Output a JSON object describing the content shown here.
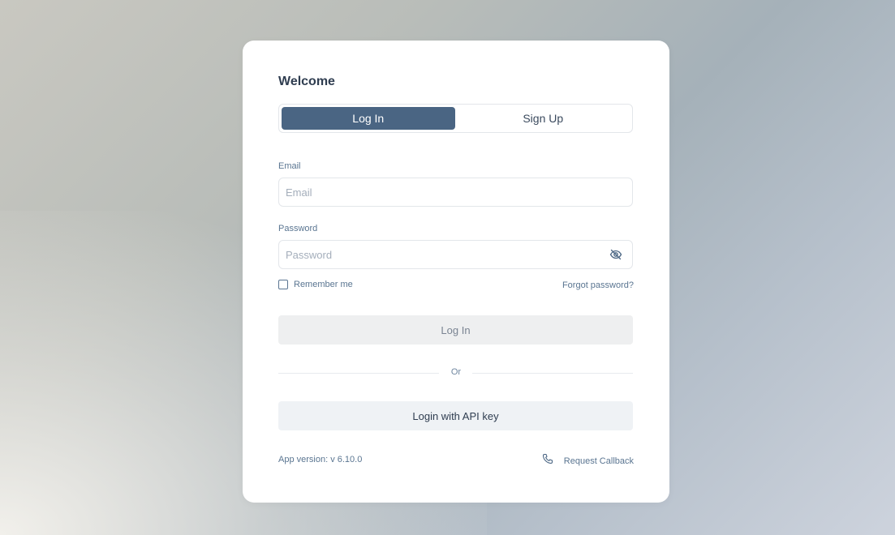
{
  "form": {
    "title": "Welcome",
    "tabs": [
      {
        "label": "Log In",
        "active": true
      },
      {
        "label": "Sign Up",
        "active": false
      }
    ],
    "email": {
      "label": "Email",
      "placeholder": "Email",
      "value": ""
    },
    "password": {
      "label": "Password",
      "placeholder": "Password",
      "value": "",
      "toggle_icon": "eye-off-icon"
    },
    "remember_me": {
      "label": "Remember me",
      "checked": false
    },
    "forgot_password": "Forgot password?",
    "submit_label": "Log In",
    "divider_text": "Or",
    "api_key_label": "Login with API key"
  },
  "footer": {
    "version": "App version: v 6.10.0",
    "callback_label": "Request Callback",
    "callback_icon": "phone-icon"
  },
  "colors": {
    "accent": "#4a6583",
    "text_primary": "#2f3d50",
    "text_secondary": "#5a7591"
  }
}
